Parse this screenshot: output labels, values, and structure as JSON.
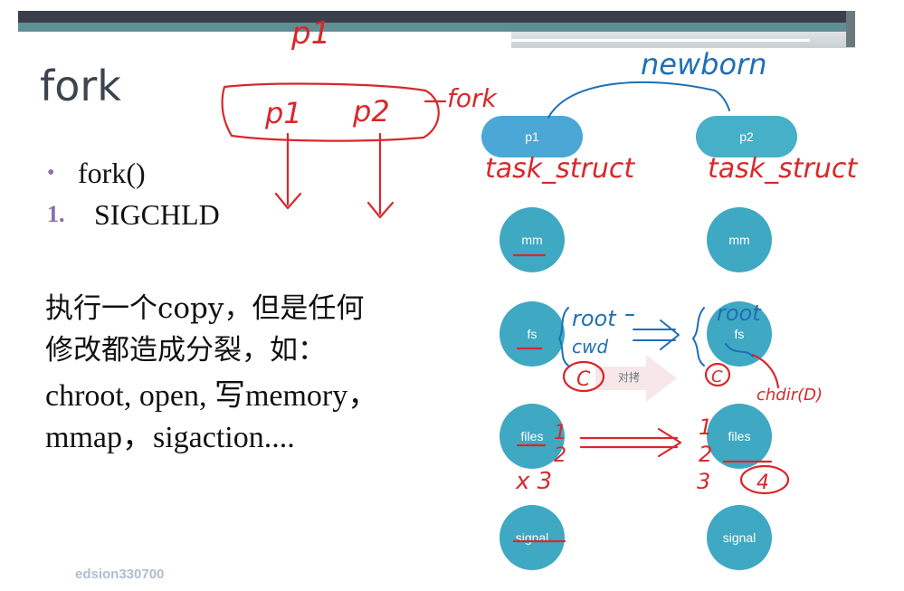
{
  "slide": {
    "title": "fork",
    "bullets": [
      {
        "marker": "•",
        "text": "fork()"
      },
      {
        "marker": "1.",
        "text": "SIGCHLD"
      }
    ],
    "paragraph_cn": "执行一个copy，但是任何\n修改都造成分裂，如：",
    "paragraph_en": "chroot, open, 写memory，\nmmap，sigaction....",
    "watermark": "edsion330700"
  },
  "diagram": {
    "parent": "p1",
    "child": "p2",
    "resources": [
      "mm",
      "fs",
      "files",
      "signal"
    ],
    "copy_label": "对拷"
  },
  "annotations": {
    "top_p1": "p1",
    "box_p1": "p1",
    "box_p2": "p2",
    "fork": "fork",
    "newborn": "newborn",
    "task_struct_left": "task_struct",
    "task_struct_right": "task_struct",
    "root": "root",
    "cwd": "cwd",
    "root_right": "root",
    "c_left": "C",
    "c_right": "C",
    "chdir": "chdir(D)",
    "files_left": "1\n2",
    "x3": "x 3",
    "files_right": "1\n2\n3",
    "four": "4"
  },
  "colors": {
    "ink_red": "#d8282b",
    "ink_blue": "#1f6fb5",
    "node": "#3fa8c2",
    "accent_purple": "#8a6ab3"
  }
}
